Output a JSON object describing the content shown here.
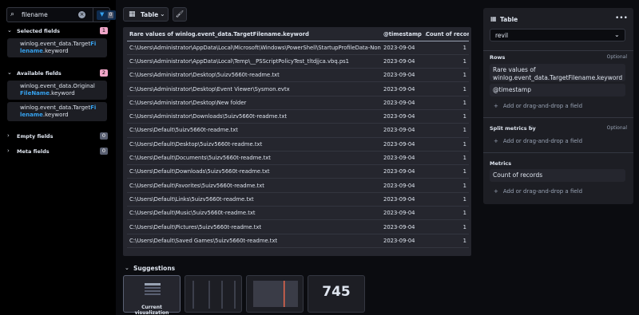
{
  "sidebar": {
    "search_value": "filename",
    "filter_count": "0",
    "selected": {
      "label": "Selected fields",
      "count": "1",
      "fields": [
        {
          "pre": "winlog.event_data.Target",
          "hl": "Fi",
          "hl2": "lename",
          "post": ".keyword"
        }
      ]
    },
    "available": {
      "label": "Available fields",
      "count": "2",
      "fields": [
        {
          "pre": "winlog.event_data.Original",
          "hl": "FileName",
          "post": ".keyword"
        },
        {
          "pre": "winlog.event_data.Target",
          "hl": "Fi",
          "hl2": "lename",
          "post": ".keyword"
        }
      ]
    },
    "empty": {
      "label": "Empty fields",
      "count": "0"
    },
    "meta": {
      "label": "Meta fields",
      "count": "0"
    }
  },
  "toolbar": {
    "table_label": "Table"
  },
  "table": {
    "headers": [
      "Rare values of winlog.event_data.TargetFilename.keyword",
      "@timestamp",
      "Count of records"
    ],
    "rows": [
      [
        "C:\\Users\\Administrator\\AppData\\Local\\Microsoft\\Windows\\PowerShell\\StartupProfileData-NonInteractive",
        "2023-09-04",
        "1"
      ],
      [
        "C:\\Users\\Administrator\\AppData\\Local\\Temp\\__PSScriptPolicyTest_tltdjjca.vbq.ps1",
        "2023-09-04",
        "1"
      ],
      [
        "C:\\Users\\Administrator\\Desktop\\5uizv5660t-readme.txt",
        "2023-09-04",
        "1"
      ],
      [
        "C:\\Users\\Administrator\\Desktop\\Event Viewer\\Sysmon.evtx",
        "2023-09-04",
        "1"
      ],
      [
        "C:\\Users\\Administrator\\Desktop\\New folder",
        "2023-09-04",
        "1"
      ],
      [
        "C:\\Users\\Administrator\\Downloads\\5uizv5660t-readme.txt",
        "2023-09-04",
        "1"
      ],
      [
        "C:\\Users\\Default\\5uizv5660t-readme.txt",
        "2023-09-04",
        "1"
      ],
      [
        "C:\\Users\\Default\\Desktop\\5uizv5660t-readme.txt",
        "2023-09-04",
        "1"
      ],
      [
        "C:\\Users\\Default\\Documents\\5uizv5660t-readme.txt",
        "2023-09-04",
        "1"
      ],
      [
        "C:\\Users\\Default\\Downloads\\5uizv5660t-readme.txt",
        "2023-09-04",
        "1"
      ],
      [
        "C:\\Users\\Default\\Favorites\\5uizv5660t-readme.txt",
        "2023-09-04",
        "1"
      ],
      [
        "C:\\Users\\Default\\Links\\5uizv5660t-readme.txt",
        "2023-09-04",
        "1"
      ],
      [
        "C:\\Users\\Default\\Music\\5uizv5660t-readme.txt",
        "2023-09-04",
        "1"
      ],
      [
        "C:\\Users\\Default\\Pictures\\5uizv5660t-readme.txt",
        "2023-09-04",
        "1"
      ],
      [
        "C:\\Users\\Default\\Saved Games\\5uizv5660t-readme.txt",
        "2023-09-04",
        "1"
      ]
    ]
  },
  "suggestions": {
    "title": "Suggestions",
    "current_label": "Current visualization",
    "metric_value": "745"
  },
  "config": {
    "title": "Table",
    "index_pattern": "revil",
    "rows_label": "Rows",
    "optional": "Optional",
    "rows_dims": [
      "Rare values of winlog.event_data.TargetFilename.keyword",
      "@timestamp"
    ],
    "add_field": "Add or drag-and-drop a field",
    "split_label": "Split metrics by",
    "metrics_label": "Metrics",
    "metrics_dims": [
      "Count of records"
    ]
  },
  "colors": {
    "accent": "#36a2ef",
    "pink_badge": "#f0a6c8",
    "bg": "#0b0c10",
    "panel": "#25262e"
  }
}
